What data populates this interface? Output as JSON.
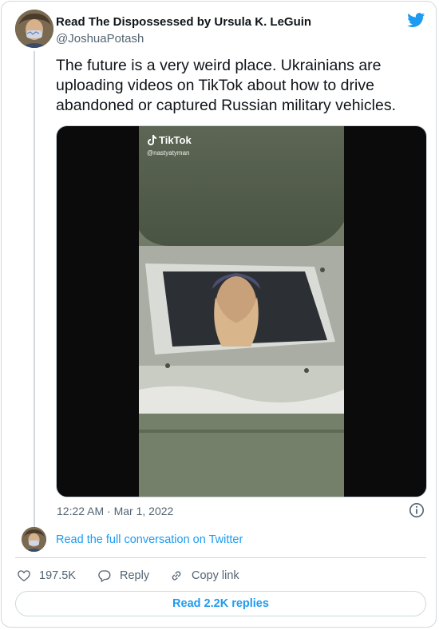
{
  "author": {
    "name": "Read The Dispossessed by Ursula K. LeGuin",
    "handle": "@JoshuaPotash"
  },
  "tweet": {
    "text": "The future is a very weird place. Ukrainians are uploading videos on TikTok about how to drive abandoned or captured Russian military vehicles.",
    "timestamp": "12:22 AM · Mar 1, 2022"
  },
  "media": {
    "watermark": "TikTok",
    "watermark_handle": "@nastyatyman"
  },
  "conversation": {
    "link_label": "Read the full conversation on Twitter"
  },
  "actions": {
    "likes": "197.5K",
    "reply_label": "Reply",
    "copy_link_label": "Copy link"
  },
  "replies": {
    "button_label": "Read 2.2K replies"
  },
  "colors": {
    "accent": "#1d9bf0",
    "secondary_text": "#536471",
    "border": "#cfd9de"
  },
  "icons": [
    "twitter-bird-icon",
    "info-icon",
    "heart-icon",
    "reply-bubble-icon",
    "link-icon",
    "tiktok-note-icon"
  ]
}
